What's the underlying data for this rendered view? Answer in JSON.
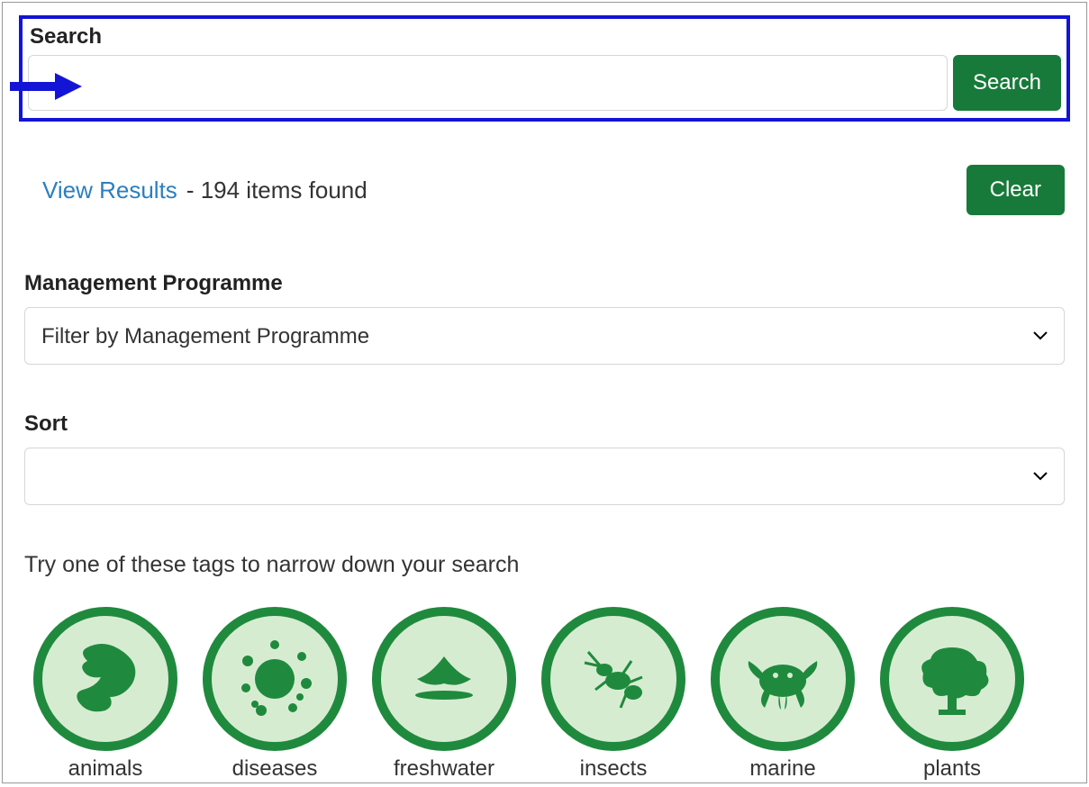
{
  "search": {
    "label": "Search",
    "button": "Search",
    "value": ""
  },
  "results": {
    "view_link": "View Results",
    "items_found": "- 194 items found",
    "clear_button": "Clear"
  },
  "filters": {
    "programme_label": "Management Programme",
    "programme_placeholder": "Filter by Management Programme",
    "sort_label": "Sort",
    "sort_placeholder": ""
  },
  "tags_hint": "Try one of these tags to narrow down your search",
  "tags": [
    {
      "name": "animals"
    },
    {
      "name": "diseases"
    },
    {
      "name": "freshwater"
    },
    {
      "name": "insects"
    },
    {
      "name": "marine"
    },
    {
      "name": "plants"
    }
  ],
  "colors": {
    "accent_green": "#187a3a",
    "highlight_blue": "#1414d6",
    "link_blue": "#2a7fbf"
  }
}
